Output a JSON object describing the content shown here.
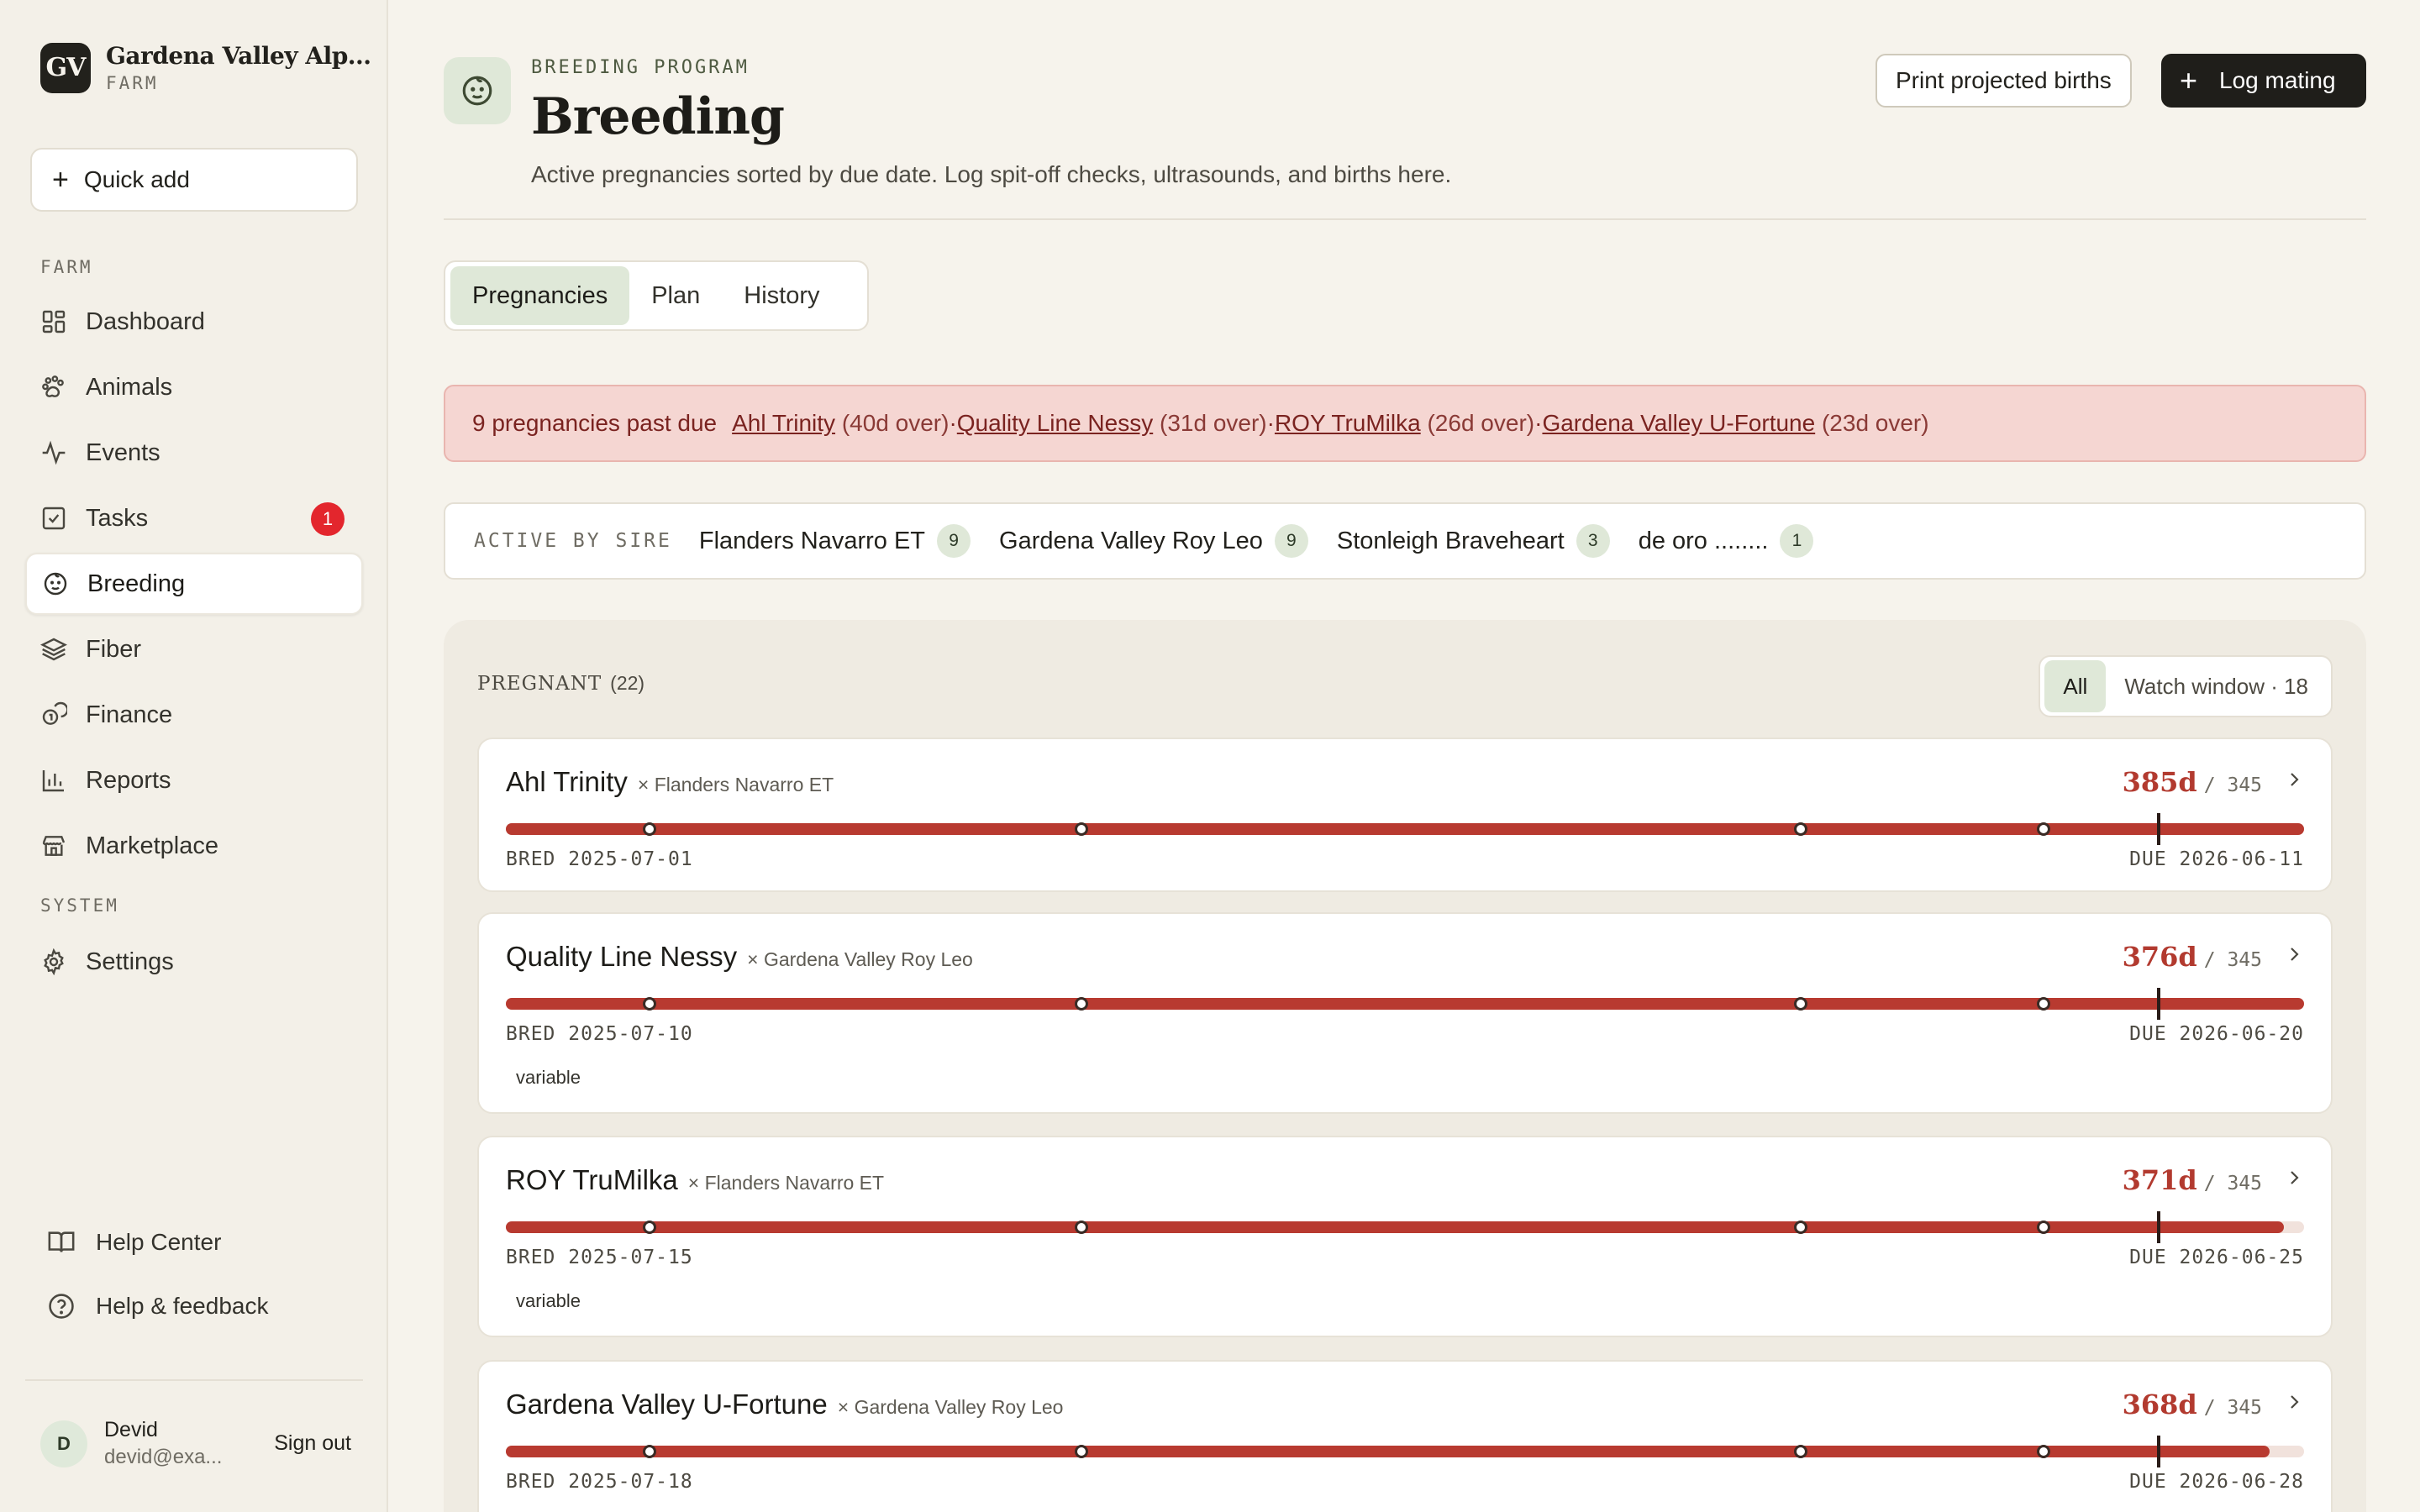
{
  "brand": {
    "initials": "GV",
    "name": "Gardena Valley Alp...",
    "sub": "FARM"
  },
  "quick_add": {
    "label": "Quick add"
  },
  "nav": {
    "farm_label": "FARM",
    "system_label": "SYSTEM",
    "items": [
      {
        "label": "Dashboard",
        "icon": "grid-icon"
      },
      {
        "label": "Animals",
        "icon": "paw-icon"
      },
      {
        "label": "Events",
        "icon": "pulse-icon"
      },
      {
        "label": "Tasks",
        "icon": "checkbox-icon",
        "badge": "1"
      },
      {
        "label": "Breeding",
        "icon": "baby-face-icon",
        "active": true
      },
      {
        "label": "Fiber",
        "icon": "layers-icon"
      },
      {
        "label": "Finance",
        "icon": "coins-icon"
      },
      {
        "label": "Reports",
        "icon": "bar-chart-icon"
      },
      {
        "label": "Marketplace",
        "icon": "store-icon"
      }
    ],
    "settings": {
      "label": "Settings",
      "icon": "gear-icon"
    }
  },
  "help": {
    "center": "Help Center",
    "feedback": "Help & feedback"
  },
  "user": {
    "initial": "D",
    "name": "Devid",
    "email": "devid@exa...",
    "sign_out": "Sign out"
  },
  "header": {
    "eyebrow": "BREEDING PROGRAM",
    "title": "Breeding",
    "subtitle": "Active pregnancies sorted by due date. Log spit-off checks, ultrasounds, and births here.",
    "print_button": "Print projected births",
    "log_button": "Log mating"
  },
  "tabs": [
    "Pregnancies",
    "Plan",
    "History"
  ],
  "alert": {
    "count_text": "9 pregnancies past due",
    "items": [
      {
        "name": "Ahl Trinity",
        "over": "(40d over)"
      },
      {
        "name": "Quality Line Nessy",
        "over": "(31d over)"
      },
      {
        "name": "ROY TruMilka",
        "over": "(26d over)"
      },
      {
        "name": "Gardena Valley U-Fortune",
        "over": "(23d over)"
      }
    ],
    "separator": " · "
  },
  "sires": {
    "label": "ACTIVE BY SIRE",
    "items": [
      {
        "name": "Flanders Navarro ET",
        "count": "9"
      },
      {
        "name": "Gardena Valley Roy Leo",
        "count": "9"
      },
      {
        "name": "Stonleigh Braveheart",
        "count": "3"
      },
      {
        "name": "de oro ........",
        "count": "1"
      }
    ]
  },
  "pregnant": {
    "title": "PREGNANT",
    "count": "(22)",
    "filter_all": "All",
    "filter_watch": "Watch window · 18"
  },
  "cards": [
    {
      "name": "Ahl Trinity",
      "sire": "× Flanders Navarro ET",
      "days": "385d",
      "of": "/ 345",
      "bred": "BRED 2025-07-01",
      "due": "DUE 2026-06-11",
      "progress": 1.0,
      "tag": ""
    },
    {
      "name": "Quality Line Nessy",
      "sire": "× Gardena Valley Roy Leo",
      "days": "376d",
      "of": "/ 345",
      "bred": "BRED 2025-07-10",
      "due": "DUE 2026-06-20",
      "progress": 1.0,
      "tag": "variable"
    },
    {
      "name": "ROY TruMilka",
      "sire": "× Flanders Navarro ET",
      "days": "371d",
      "of": "/ 345",
      "bred": "BRED 2025-07-15",
      "due": "DUE 2026-06-25",
      "progress": 0.989,
      "tag": "variable"
    },
    {
      "name": "Gardena Valley U-Fortune",
      "sire": "× Gardena Valley Roy Leo",
      "days": "368d",
      "of": "/ 345",
      "bred": "BRED 2025-07-18",
      "due": "DUE 2026-06-28",
      "progress": 0.981,
      "tag": ""
    }
  ],
  "timeline_markers": [
    0.08,
    0.32,
    0.72,
    0.855
  ],
  "due_marker": 0.919,
  "colors": {
    "accent_red": "#b83a30",
    "sage": "#dfe8d8",
    "alert_bg": "#f5d6d2",
    "dark": "#1f1e1a"
  }
}
